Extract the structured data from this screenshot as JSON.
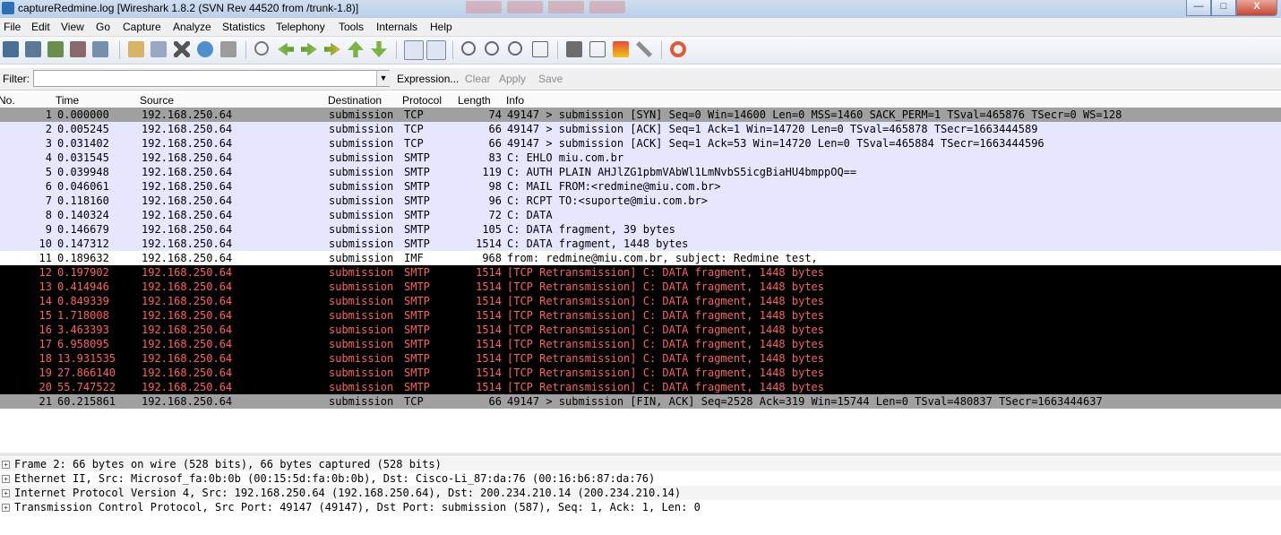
{
  "window": {
    "title": "captureRedmine.log   [Wireshark 1.8.2  (SVN Rev 44520 from /trunk-1.8)]",
    "controls": {
      "minimize": "—",
      "maximize": "□",
      "close": "X"
    }
  },
  "menu": [
    "File",
    "Edit",
    "View",
    "Go",
    "Capture",
    "Analyze",
    "Statistics",
    "Telephony",
    "Tools",
    "Internals",
    "Help"
  ],
  "toolbar": {
    "icons": [
      "interface-list-icon",
      "capture-options-icon",
      "start-capture-icon",
      "stop-capture-icon",
      "restart-capture-icon",
      "open-file-icon",
      "save-file-icon",
      "close-file-icon",
      "reload-icon",
      "print-icon",
      "find-packet-icon",
      "go-back-icon",
      "go-forward-icon",
      "go-to-packet-icon",
      "go-first-icon",
      "go-last-icon",
      "colorize-icon",
      "auto-scroll-icon",
      "zoom-in-icon",
      "zoom-out-icon",
      "zoom-normal-icon",
      "resize-columns-icon",
      "capture-filters-icon",
      "display-filters-icon",
      "coloring-rules-icon",
      "preferences-icon",
      "help-icon"
    ]
  },
  "filter": {
    "label": "Filter:",
    "value": "",
    "expression": "Expression...",
    "clear": "Clear",
    "apply": "Apply",
    "save": "Save"
  },
  "columns": {
    "no": "No.",
    "time": "Time",
    "source": "Source",
    "destination": "Destination",
    "protocol": "Protocol",
    "length": "Length",
    "info": "Info"
  },
  "packets": [
    {
      "no": "1",
      "time": "0.000000",
      "src": "192.168.250.64",
      "dst": "submission",
      "proto": "TCP",
      "len": "74",
      "info": "49147 > submission [SYN] Seq=0 Win=14600 Len=0 MSS=1460 SACK_PERM=1 TSval=465876 TSecr=0 WS=128",
      "style": "tcp-sel"
    },
    {
      "no": "2",
      "time": "0.005245",
      "src": "192.168.250.64",
      "dst": "submission",
      "proto": "TCP",
      "len": "66",
      "info": "49147 > submission [ACK] Seq=1 Ack=1 Win=14720 Len=0 TSval=465878 TSecr=1663444589",
      "style": "tcp"
    },
    {
      "no": "3",
      "time": "0.031402",
      "src": "192.168.250.64",
      "dst": "submission",
      "proto": "TCP",
      "len": "66",
      "info": "49147 > submission [ACK] Seq=1 Ack=53 Win=14720 Len=0 TSval=465884 TSecr=1663444596",
      "style": "tcp"
    },
    {
      "no": "4",
      "time": "0.031545",
      "src": "192.168.250.64",
      "dst": "submission",
      "proto": "SMTP",
      "len": "83",
      "info": "C: EHLO miu.com.br",
      "style": "smtp"
    },
    {
      "no": "5",
      "time": "0.039948",
      "src": "192.168.250.64",
      "dst": "submission",
      "proto": "SMTP",
      "len": "119",
      "info": "C: AUTH PLAIN AHJlZG1pbmVAbWl1LmNvbS5icgBiaHU4bmppOQ==",
      "style": "smtp"
    },
    {
      "no": "6",
      "time": "0.046061",
      "src": "192.168.250.64",
      "dst": "submission",
      "proto": "SMTP",
      "len": "98",
      "info": "C: MAIL FROM:<redmine@miu.com.br>",
      "style": "smtp"
    },
    {
      "no": "7",
      "time": "0.118160",
      "src": "192.168.250.64",
      "dst": "submission",
      "proto": "SMTP",
      "len": "96",
      "info": "C: RCPT TO:<suporte@miu.com.br>",
      "style": "smtp"
    },
    {
      "no": "8",
      "time": "0.140324",
      "src": "192.168.250.64",
      "dst": "submission",
      "proto": "SMTP",
      "len": "72",
      "info": "C: DATA",
      "style": "smtp"
    },
    {
      "no": "9",
      "time": "0.146679",
      "src": "192.168.250.64",
      "dst": "submission",
      "proto": "SMTP",
      "len": "105",
      "info": "C: DATA fragment, 39 bytes",
      "style": "smtp"
    },
    {
      "no": "10",
      "time": "0.147312",
      "src": "192.168.250.64",
      "dst": "submission",
      "proto": "SMTP",
      "len": "1514",
      "info": "C: DATA fragment, 1448 bytes",
      "style": "smtp"
    },
    {
      "no": "11",
      "time": "0.189632",
      "src": "192.168.250.64",
      "dst": "submission",
      "proto": "IMF",
      "len": "968",
      "info": "from: redmine@miu.com.br, subject: Redmine test,",
      "style": "imf"
    },
    {
      "no": "12",
      "time": "0.197902",
      "src": "192.168.250.64",
      "dst": "submission",
      "proto": "SMTP",
      "len": "1514",
      "info": "[TCP Retransmission] C: DATA fragment, 1448 bytes",
      "style": "retrans"
    },
    {
      "no": "13",
      "time": "0.414946",
      "src": "192.168.250.64",
      "dst": "submission",
      "proto": "SMTP",
      "len": "1514",
      "info": "[TCP Retransmission] C: DATA fragment, 1448 bytes",
      "style": "retrans"
    },
    {
      "no": "14",
      "time": "0.849339",
      "src": "192.168.250.64",
      "dst": "submission",
      "proto": "SMTP",
      "len": "1514",
      "info": "[TCP Retransmission] C: DATA fragment, 1448 bytes",
      "style": "retrans"
    },
    {
      "no": "15",
      "time": "1.718008",
      "src": "192.168.250.64",
      "dst": "submission",
      "proto": "SMTP",
      "len": "1514",
      "info": "[TCP Retransmission] C: DATA fragment, 1448 bytes",
      "style": "retrans"
    },
    {
      "no": "16",
      "time": "3.463393",
      "src": "192.168.250.64",
      "dst": "submission",
      "proto": "SMTP",
      "len": "1514",
      "info": "[TCP Retransmission] C: DATA fragment, 1448 bytes",
      "style": "retrans"
    },
    {
      "no": "17",
      "time": "6.958095",
      "src": "192.168.250.64",
      "dst": "submission",
      "proto": "SMTP",
      "len": "1514",
      "info": "[TCP Retransmission] C: DATA fragment, 1448 bytes",
      "style": "retrans"
    },
    {
      "no": "18",
      "time": "13.931535",
      "src": "192.168.250.64",
      "dst": "submission",
      "proto": "SMTP",
      "len": "1514",
      "info": "[TCP Retransmission] C: DATA fragment, 1448 bytes",
      "style": "retrans"
    },
    {
      "no": "19",
      "time": "27.866140",
      "src": "192.168.250.64",
      "dst": "submission",
      "proto": "SMTP",
      "len": "1514",
      "info": "[TCP Retransmission] C: DATA fragment, 1448 bytes",
      "style": "retrans"
    },
    {
      "no": "20",
      "time": "55.747522",
      "src": "192.168.250.64",
      "dst": "submission",
      "proto": "SMTP",
      "len": "1514",
      "info": "[TCP Retransmission] C: DATA fragment, 1448 bytes",
      "style": "retrans"
    },
    {
      "no": "21",
      "time": "60.215861",
      "src": "192.168.250.64",
      "dst": "submission",
      "proto": "TCP",
      "len": "66",
      "info": "49147 > submission [FIN, ACK] Seq=2528 Ack=319 Win=15744 Len=0 TSval=480837 TSecr=1663444637",
      "style": "fin"
    }
  ],
  "details": [
    "Frame 2: 66 bytes on wire (528 bits), 66 bytes captured (528 bits)",
    "Ethernet II, Src: Microsof_fa:0b:0b (00:15:5d:fa:0b:0b), Dst: Cisco-Li_87:da:76 (00:16:b6:87:da:76)",
    "Internet Protocol Version 4, Src: 192.168.250.64 (192.168.250.64), Dst: 200.234.210.14 (200.234.210.14)",
    "Transmission Control Protocol, Src Port: 49147 (49147), Dst Port: submission (587), Seq: 1, Ack: 1, Len: 0"
  ],
  "colors": {
    "tcp_selected": "#a0a0a0",
    "tcp": "#e7e6ff",
    "retrans_bg": "#000000",
    "retrans_fg": "#ff5f5f"
  }
}
